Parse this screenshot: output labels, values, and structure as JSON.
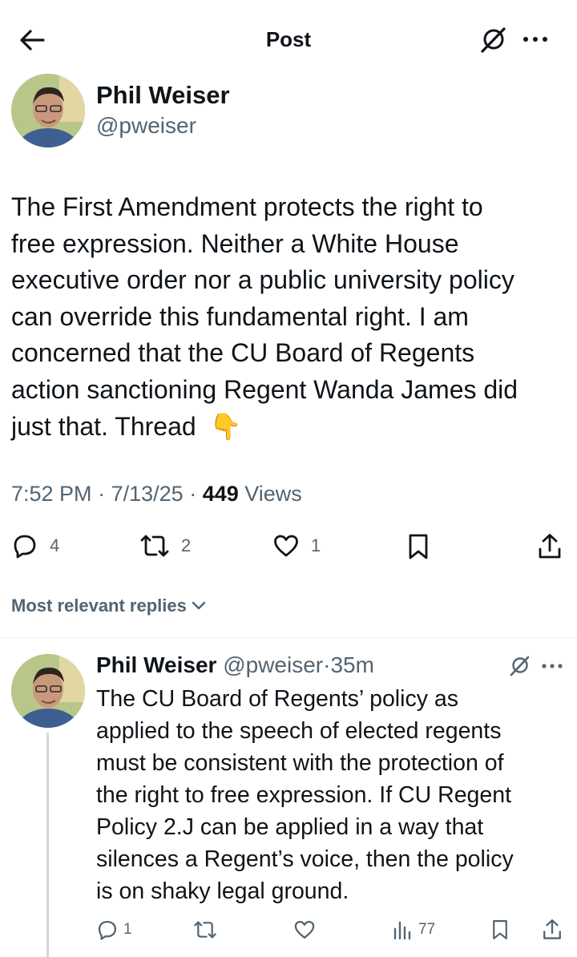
{
  "header": {
    "title": "Post"
  },
  "icons": {
    "back": "arrow-left-icon",
    "grok": "grok-icon",
    "more": "more-horizontal-icon",
    "reply": "reply-icon",
    "repost": "repost-icon",
    "like": "heart-icon",
    "bookmark": "bookmark-icon",
    "share": "share-icon",
    "views": "bar-chart-icon"
  },
  "main_post": {
    "author_name": "Phil Weiser",
    "handle": "@pweiser",
    "text_lines": [
      "The First Amendment protects the right to",
      "free expression. Neither a White House",
      "executive order nor a public university policy",
      "can override this fundamental right. I am",
      "concerned that the CU Board of Regents",
      "action sanctioning Regent Wanda James did",
      "just that. Thread"
    ],
    "emoji": "👇",
    "time": "7:52 PM",
    "date": "7/13/25",
    "views_count": "449",
    "views_label": "Views",
    "replies": "4",
    "reposts": "2",
    "likes": "1"
  },
  "replies_filter": {
    "label": "Most relevant replies"
  },
  "reply_post": {
    "author_name": "Phil Weiser",
    "handle": "@pweiser",
    "age": "35m",
    "text_lines": [
      "The CU Board of Regents’ policy as",
      "applied to the speech of elected regents",
      "must be consistent with the protection of",
      "the right to free expression. If CU Regent",
      "Policy 2.J can be applied in a way that",
      "silences a Regent’s voice, then the policy",
      "is on shaky legal ground."
    ],
    "replies": "1",
    "views": "77"
  },
  "colors": {
    "text": "#0f1419",
    "muted": "#536471",
    "divider": "#eff3f4"
  }
}
